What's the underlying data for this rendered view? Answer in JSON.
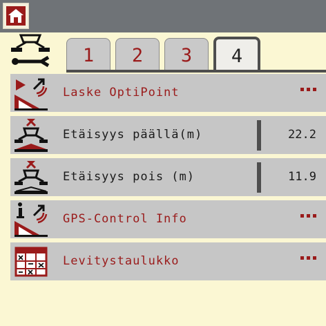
{
  "tabs": [
    {
      "label": "1",
      "active": false
    },
    {
      "label": "2",
      "active": false
    },
    {
      "label": "3",
      "active": false
    },
    {
      "label": "4",
      "active": true
    }
  ],
  "rows": [
    {
      "label": "Laske OptiPoint",
      "icon": "optipoint-calc-icon",
      "action": "..."
    },
    {
      "label": "Etäisyys päällä(m)",
      "icon": "distance-on-icon",
      "value": "22.2"
    },
    {
      "label": "Etäisyys pois (m)",
      "icon": "distance-off-icon",
      "value": "11.9"
    },
    {
      "label": "GPS-Control Info",
      "icon": "gps-info-icon",
      "action": "..."
    },
    {
      "label": "Levitystaulukko",
      "icon": "spread-table-icon",
      "action": "..."
    }
  ],
  "colors": {
    "accent_red": "#9a1b1b",
    "row_bg": "#c6c6c6",
    "page_bg": "#fbf7d3",
    "topbar_bg": "#6f7377"
  }
}
